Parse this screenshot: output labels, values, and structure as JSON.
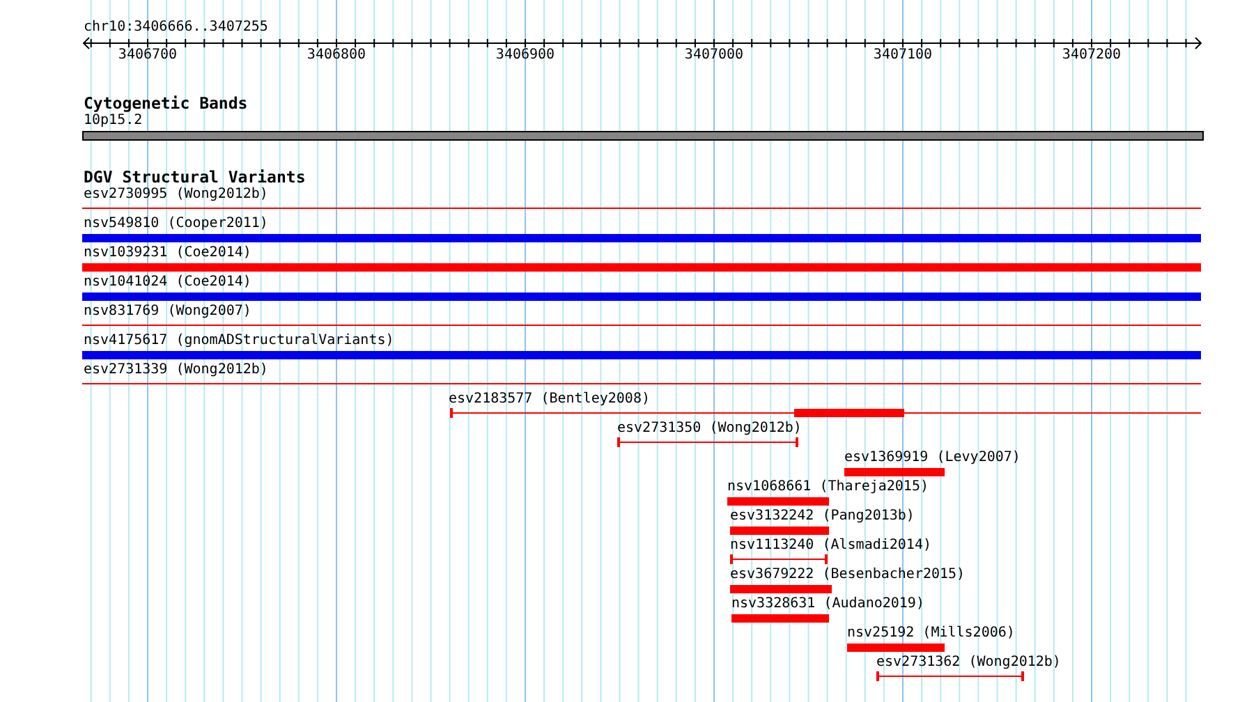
{
  "ruler": {
    "location": "chr10:3406666..3407255",
    "ticks": [
      "3406700",
      "3406800",
      "3406900",
      "3407000",
      "3407100",
      "3407200"
    ]
  },
  "tracks": [
    {
      "title": "Cytogenetic Bands",
      "features": [
        {
          "label": "10p15.2",
          "kind": "band"
        }
      ]
    },
    {
      "title": "DGV Structural Variants",
      "features": [
        {
          "label": "esv2730995 (Wong2012b)",
          "kind": "line",
          "color": "#ff0000"
        },
        {
          "label": "nsv549810 (Cooper2011)",
          "kind": "bar",
          "color": "#0000ee"
        },
        {
          "label": "nsv1039231 (Coe2014)",
          "kind": "bar",
          "color": "#ff0000"
        },
        {
          "label": "nsv1041024 (Coe2014)",
          "kind": "bar",
          "color": "#0000ee"
        },
        {
          "label": "nsv831769 (Wong2007)",
          "kind": "line",
          "color": "#ff0000"
        },
        {
          "label": "nsv4175617 (gnomADStructuralVariants)",
          "kind": "bar",
          "color": "#0000ee"
        },
        {
          "label": "esv2731339 (Wong2012b)",
          "kind": "line",
          "color": "#ff0000"
        },
        {
          "label": "esv2183577 (Bentley2008)",
          "kind": "split",
          "color": "#ff0000"
        },
        {
          "label": "esv2731350 (Wong2012b)",
          "kind": "line",
          "color": "#ff0000"
        },
        {
          "label": "esv1369919 (Levy2007)",
          "kind": "bar",
          "color": "#ff0000"
        },
        {
          "label": "nsv1068661 (Thareja2015)",
          "kind": "bar",
          "color": "#ff0000"
        },
        {
          "label": "esv3132242 (Pang2013b)",
          "kind": "bar",
          "color": "#ff0000"
        },
        {
          "label": "nsv1113240 (Alsmadi2014)",
          "kind": "line",
          "color": "#ff0000"
        },
        {
          "label": "esv3679222 (Besenbacher2015)",
          "kind": "bar",
          "color": "#ff0000"
        },
        {
          "label": "nsv3328631 (Audano2019)",
          "kind": "bar",
          "color": "#ff0000"
        },
        {
          "label": "nsv25192 (Mills2006)",
          "kind": "bar",
          "color": "#ff0000"
        },
        {
          "label": "esv2731362 (Wong2012b)",
          "kind": "line",
          "color": "#ff0000"
        }
      ]
    }
  ]
}
